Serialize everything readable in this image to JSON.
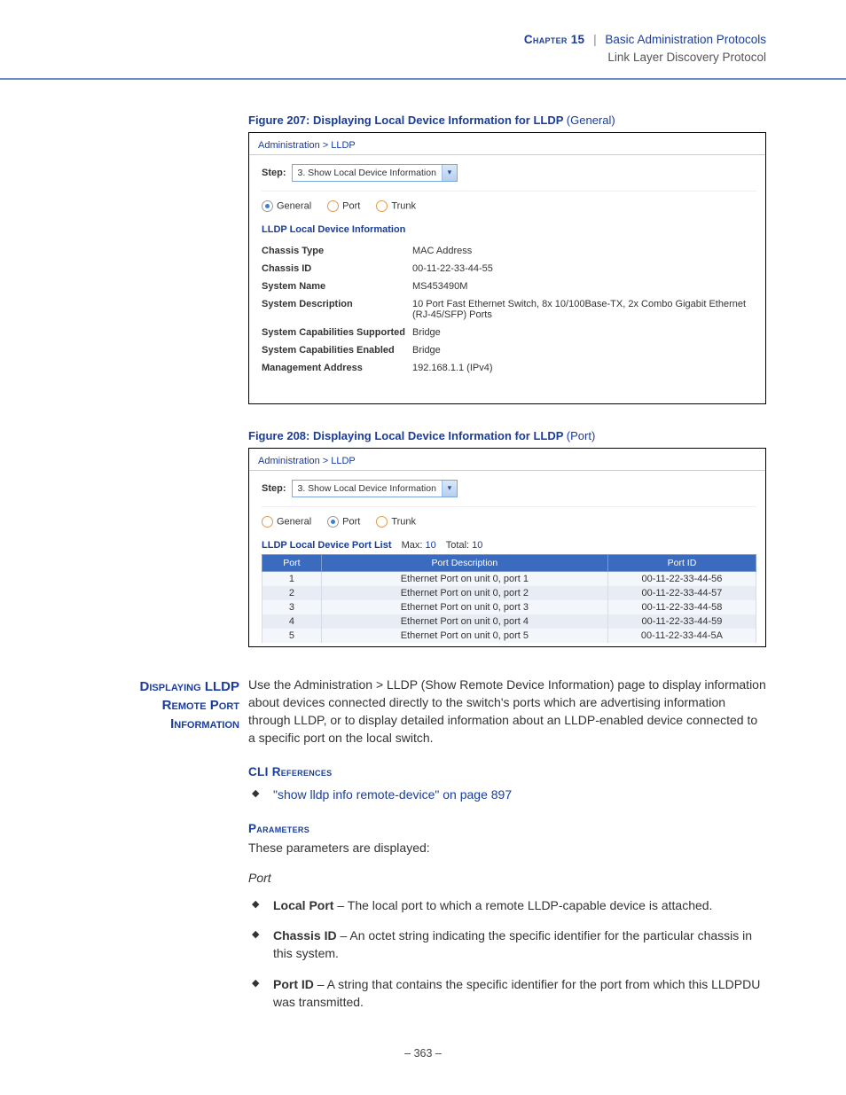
{
  "header": {
    "chapter": "Chapter 15",
    "title": "Basic Administration Protocols",
    "subtitle": "Link Layer Discovery Protocol"
  },
  "fig207": {
    "caption_main": "Figure 207:  Displaying Local Device Information for LLDP",
    "caption_paren": "(General)",
    "breadcrumb": "Administration > LLDP",
    "step_label": "Step:",
    "step_value": "3. Show Local Device Information",
    "radios": {
      "general": "General",
      "port": "Port",
      "trunk": "Trunk"
    },
    "section": "LLDP Local Device Information",
    "rows": [
      {
        "k": "Chassis Type",
        "v": "MAC Address"
      },
      {
        "k": "Chassis ID",
        "v": "00-11-22-33-44-55"
      },
      {
        "k": "System Name",
        "v": "MS453490M"
      },
      {
        "k": "System Description",
        "v": "10 Port Fast Ethernet Switch, 8x 10/100Base-TX, 2x Combo Gigabit Ethernet (RJ-45/SFP) Ports"
      },
      {
        "k": "System Capabilities Supported",
        "v": "Bridge"
      },
      {
        "k": "System Capabilities Enabled",
        "v": "Bridge"
      },
      {
        "k": "Management Address",
        "v": "192.168.1.1 (IPv4)"
      }
    ]
  },
  "fig208": {
    "caption_main": "Figure 208:  Displaying Local Device Information for LLDP",
    "caption_paren": "(Port)",
    "breadcrumb": "Administration > LLDP",
    "step_label": "Step:",
    "step_value": "3. Show Local Device Information",
    "radios": {
      "general": "General",
      "port": "Port",
      "trunk": "Trunk"
    },
    "list_title": "LLDP Local Device Port List",
    "max_label": "Max:",
    "max_value": "10",
    "total_label": "Total:",
    "total_value": "10",
    "columns": {
      "c1": "Port",
      "c2": "Port Description",
      "c3": "Port ID"
    },
    "rows": [
      {
        "p": "1",
        "d": "Ethernet Port on unit 0, port 1",
        "id": "00-11-22-33-44-56"
      },
      {
        "p": "2",
        "d": "Ethernet Port on unit 0, port 2",
        "id": "00-11-22-33-44-57"
      },
      {
        "p": "3",
        "d": "Ethernet Port on unit 0, port 3",
        "id": "00-11-22-33-44-58"
      },
      {
        "p": "4",
        "d": "Ethernet Port on unit 0, port 4",
        "id": "00-11-22-33-44-59"
      },
      {
        "p": "5",
        "d": "Ethernet Port on unit 0, port 5",
        "id": "00-11-22-33-44-5A"
      }
    ]
  },
  "section": {
    "sidehead_l1": "Displaying LLDP",
    "sidehead_l2": "Remote Port",
    "sidehead_l3": "Information",
    "intro": "Use the Administration > LLDP (Show Remote Device Information) page to display information about devices connected directly to the switch's ports which are advertising information through LLDP, or to display detailed information about an LLDP-enabled device connected to a specific port on the local switch.",
    "cli_head": "CLI References",
    "cli_link": "\"show lldp info remote-device\" on page 897",
    "params_head": "Parameters",
    "params_intro": "These parameters are displayed:",
    "group_port": "Port",
    "bullets": [
      {
        "b": "Local Port",
        "t": " – The local port to which a remote LLDP-capable device is attached."
      },
      {
        "b": "Chassis ID",
        "t": " – An octet string indicating the specific identifier for the particular chassis in this system."
      },
      {
        "b": "Port ID",
        "t": " – A string that contains the specific identifier for the port from which this LLDPDU was transmitted."
      }
    ]
  },
  "page_number": "– 363 –"
}
